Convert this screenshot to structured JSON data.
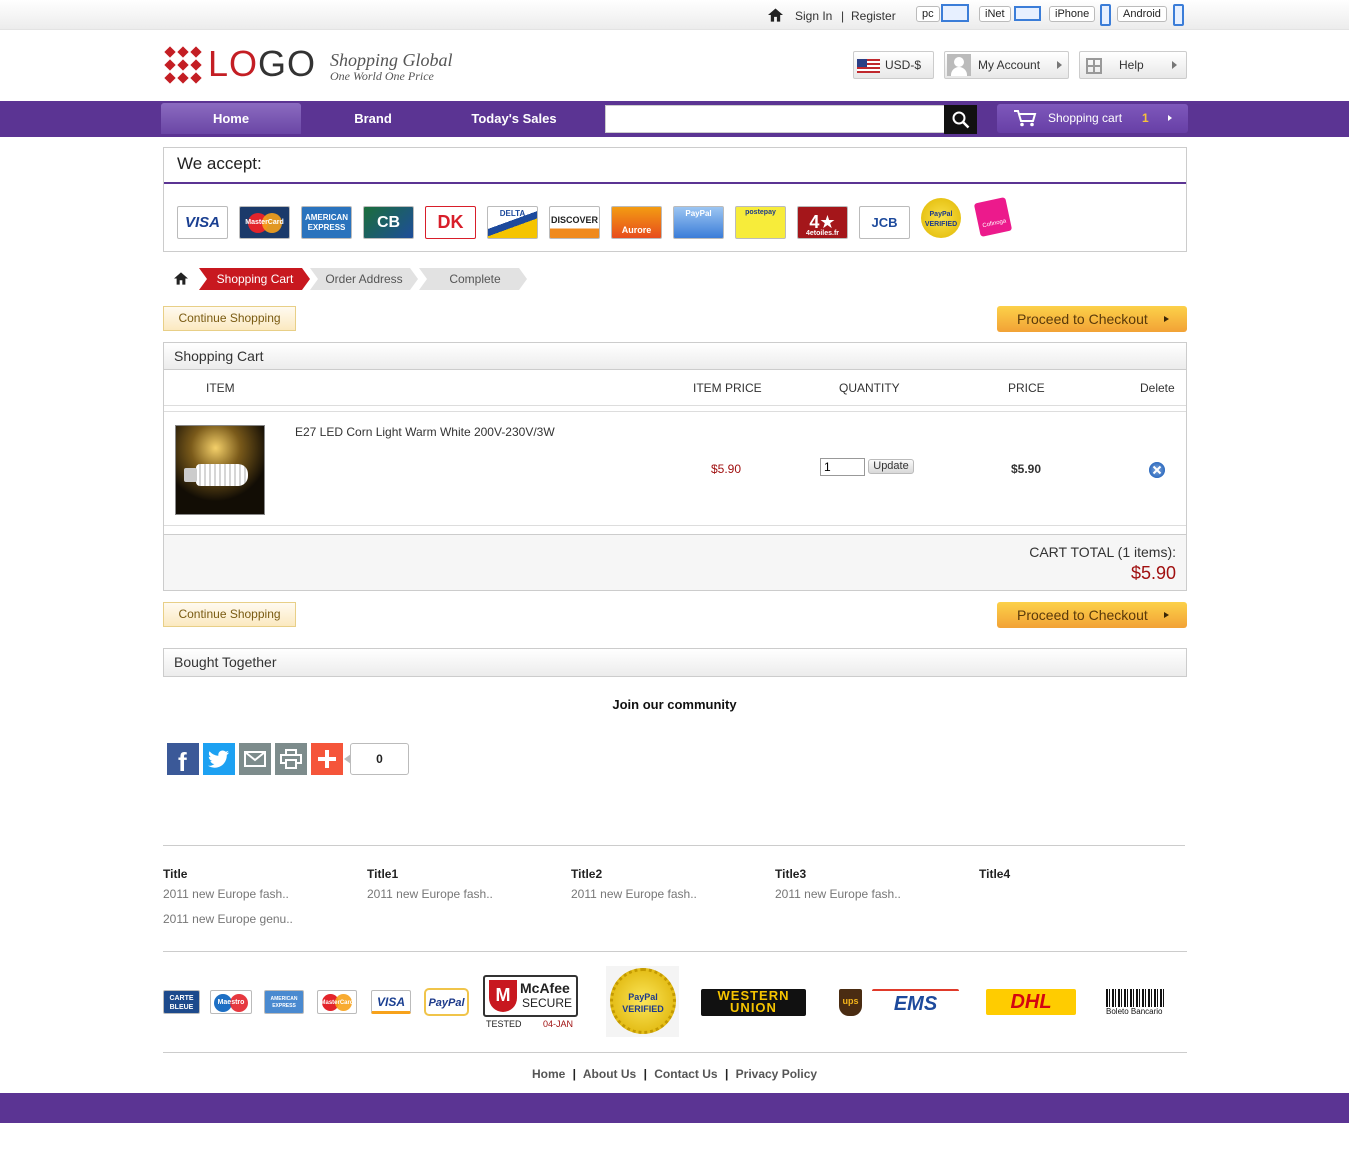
{
  "topbar": {
    "sign_in": "Sign In",
    "separator": "|",
    "register": "Register",
    "devices": [
      "pc",
      "iNet",
      "iPhone",
      "Android"
    ]
  },
  "header": {
    "logo_main": "LO",
    "logo_rest": "GO",
    "tagline_1": "Shopping Global",
    "tagline_2": "One World One Price",
    "currency": "USD-$",
    "account": "My Account",
    "help": "Help"
  },
  "nav": {
    "items": [
      "Home",
      "Brand",
      "Today's Sales"
    ],
    "search_value": "",
    "cart_label": "Shopping cart",
    "cart_count": "1"
  },
  "accept": {
    "title": "We accept:",
    "cards": [
      "VISA",
      "MasterCard",
      "AMERICAN EXPRESS",
      "CB",
      "DK",
      "DELTA",
      "DISCOVER",
      "Aurore",
      "PayPal",
      "postepay",
      "4etoiles.fr",
      "JCB",
      "PayPal VERIFIED",
      "Cofinoga"
    ]
  },
  "steps": [
    "Shopping Cart",
    "Order Address",
    "Complete"
  ],
  "buttons": {
    "continue": "Continue Shopping",
    "checkout": "Proceed to Checkout"
  },
  "cart": {
    "title": "Shopping Cart",
    "columns": [
      "ITEM",
      "ITEM PRICE",
      "QUANTITY",
      "PRICE",
      "Delete"
    ],
    "item": {
      "name": "E27 LED Corn Light Warm White 200V-230V/3W",
      "item_price": "$5.90",
      "quantity": "1",
      "update": "Update",
      "price": "$5.90"
    },
    "total_label": "CART TOTAL (1 items):",
    "total_value": "$5.90"
  },
  "bought_together": {
    "title": "Bought Together"
  },
  "community": {
    "title": "Join our community",
    "share_count": "0"
  },
  "footer": {
    "columns": [
      {
        "title": "Title",
        "links": [
          "2011 new Europe fash..",
          "2011 new Europe genu.."
        ]
      },
      {
        "title": "Title1",
        "links": [
          "2011 new Europe fash.."
        ]
      },
      {
        "title": "Title2",
        "links": [
          "2011 new Europe fash.."
        ]
      },
      {
        "title": "Title3",
        "links": [
          "2011 new Europe fash.."
        ]
      },
      {
        "title": "Title4",
        "links": []
      }
    ],
    "payments": [
      "CARTE BLEUE",
      "Maestro",
      "AMERICAN EXPRESS",
      "MasterCard",
      "VISA",
      "PayPal"
    ],
    "mcafee": {
      "brand": "McAfee",
      "secure": "SECURE",
      "tested": "TESTED",
      "date": "04-JAN"
    },
    "paypal_verified": "PayPal VERIFIED",
    "shipping": [
      "WESTERN UNION",
      "ups",
      "EMS",
      "DHL",
      "Boleto Bancario"
    ],
    "links": [
      "Home",
      "About Us",
      "Contact Us",
      "Privacy Policy"
    ],
    "link_sep": "|"
  },
  "colors": {
    "purple": "#5b3493",
    "red": "#c41e24",
    "checkout_orange": "#f2a236",
    "price_red": "#a01010"
  }
}
